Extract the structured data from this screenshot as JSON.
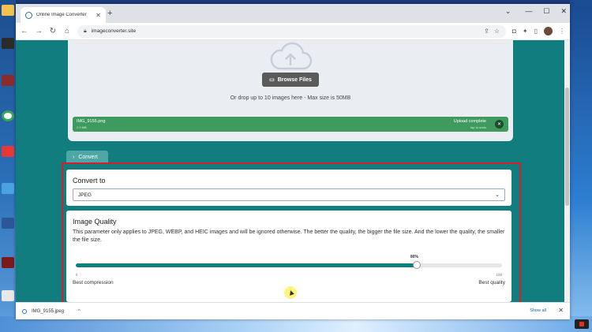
{
  "browser": {
    "tab_title": "Online Image Converter",
    "url": "imageconverter.site",
    "new_tab": "+",
    "close_tab": "✕"
  },
  "upload": {
    "browse_label": "Browse Files",
    "drop_hint": "Or drop up to 10 images here - Max size is 50MB",
    "file_name": "IMG_9155.png",
    "file_size": "2.9 MB",
    "status": "Upload complete",
    "undo_hint": "tap to undo"
  },
  "convert_tab": "Convert",
  "convert_to": {
    "heading": "Convert to",
    "selected": "JPEG"
  },
  "quality": {
    "heading": "Image Quality",
    "description": "This parameter only applies to JPEG, WEBP, and HEIC images and will be ignored otherwise. The better the quality, the bigger the file size. And the lower the quality, the smaller the file size.",
    "value_label": "80%",
    "value": 80,
    "min_label": "0",
    "max_label": "100",
    "left_caption": "Best compression",
    "right_caption": "Best quality"
  },
  "downloads": {
    "file": "IMG_9155.jpeg",
    "show_all": "Show all"
  },
  "colors": {
    "teal": "#117d7f",
    "highlight_red": "#d81e2a",
    "upload_green": "#3e9a5d"
  }
}
